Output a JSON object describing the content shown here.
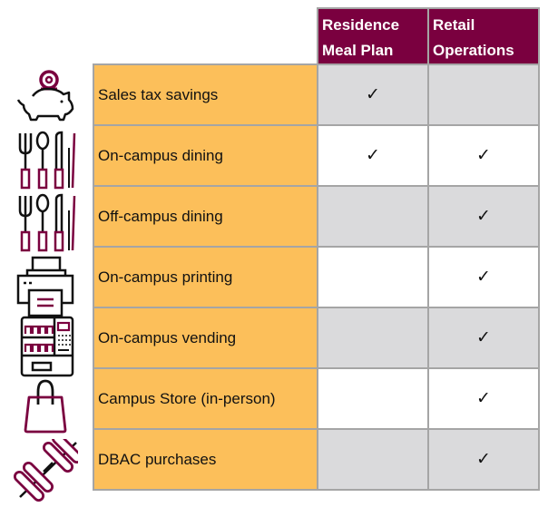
{
  "colors": {
    "header_bg": "#7a003f",
    "label_bg": "#fcbf5a",
    "gray_cell": "#dadadc",
    "border": "#a5a5a5",
    "icon_accent": "#7a003f"
  },
  "columns": [
    {
      "line1": "Residence",
      "line2": "Meal Plan"
    },
    {
      "line1": "Retail",
      "line2": "Operations"
    }
  ],
  "check_glyph": "✓",
  "rows": [
    {
      "icon": "piggy-bank-icon",
      "label": "Sales tax savings",
      "residence": "✓",
      "retail": ""
    },
    {
      "icon": "utensils-icon",
      "label": "On-campus dining",
      "residence": "✓",
      "retail": "✓"
    },
    {
      "icon": "utensils-icon",
      "label": "Off-campus dining",
      "residence": "",
      "retail": "✓"
    },
    {
      "icon": "printer-icon",
      "label": "On-campus printing",
      "residence": "",
      "retail": "✓"
    },
    {
      "icon": "vending-machine-icon",
      "label": "On-campus vending",
      "residence": "",
      "retail": "✓"
    },
    {
      "icon": "shopping-bag-icon",
      "label": "Campus Store (in-person)",
      "residence": "",
      "retail": "✓"
    },
    {
      "icon": "dumbbell-icon",
      "label": "DBAC purchases",
      "residence": "",
      "retail": "✓"
    }
  ]
}
